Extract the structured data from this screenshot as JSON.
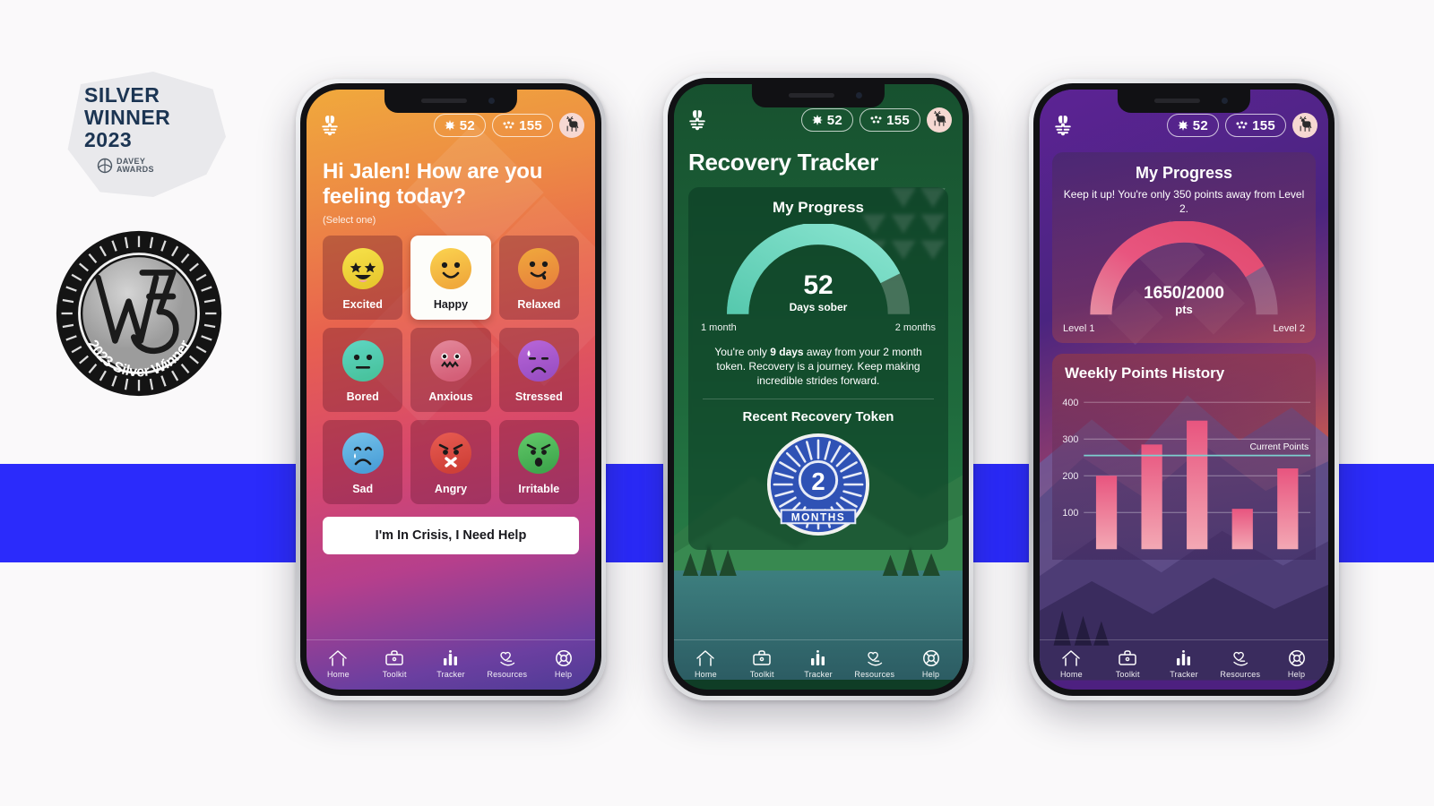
{
  "awards": {
    "davey": {
      "line1": "SILVER",
      "line2": "WINNER",
      "line3": "2023",
      "org_line1": "DAVEY",
      "org_line2": "AWARDS"
    },
    "w3": {
      "center": "W3",
      "ring_text": "2023 Silver Winner"
    }
  },
  "colors": {
    "band_blue": "#2b2bfb",
    "page_bg": "#faf9fa",
    "mood_accent": "#e8614f",
    "recovery_accent": "#6fd9c0",
    "points_accent": "#e8557f",
    "selected_card": "#fdfdfa"
  },
  "app": {
    "logo_icon": "butterfly-logo-icon",
    "streak_badge": {
      "icon": "spark-icon",
      "value": "52"
    },
    "points_badge": {
      "icon": "dots-cluster-icon",
      "value": "155"
    },
    "avatar_icon": "deer-avatar-icon"
  },
  "bottom_nav": {
    "items": [
      {
        "icon": "home-icon",
        "label": "Home"
      },
      {
        "icon": "toolkit-briefcase-icon",
        "label": "Toolkit"
      },
      {
        "icon": "tracker-bars-icon",
        "label": "Tracker"
      },
      {
        "icon": "resources-heart-hand-icon",
        "label": "Resources"
      },
      {
        "icon": "help-lifebuoy-icon",
        "label": "Help"
      }
    ]
  },
  "screen_mood": {
    "greeting": "Hi Jalen! How are you feeling today?",
    "select_hint": "(Select one)",
    "moods": [
      {
        "label": "Excited",
        "face": "star-eyes-grin",
        "color_a": "#f7e24a",
        "color_b": "#e8c82f",
        "selected": false
      },
      {
        "label": "Happy",
        "face": "smile",
        "color_a": "#fbd44f",
        "color_b": "#f0a93c",
        "selected": true
      },
      {
        "label": "Relaxed",
        "face": "smirk-tongue",
        "color_a": "#f0a93c",
        "color_b": "#e8853c",
        "selected": false
      },
      {
        "label": "Bored",
        "face": "flat-mouth",
        "color_a": "#5fd6c4",
        "color_b": "#49c39e",
        "selected": false
      },
      {
        "label": "Anxious",
        "face": "zigzag-mouth",
        "color_a": "#e4899b",
        "color_b": "#d45f78",
        "selected": false
      },
      {
        "label": "Stressed",
        "face": "sweat-frown",
        "color_a": "#b866d8",
        "color_b": "#9a4fc4",
        "selected": false
      },
      {
        "label": "Sad",
        "face": "tear-frown",
        "color_a": "#76c3ea",
        "color_b": "#4b9fd8",
        "selected": false
      },
      {
        "label": "Angry",
        "face": "x-mouth-angry",
        "color_a": "#e85c52",
        "color_b": "#cf4038",
        "selected": false
      },
      {
        "label": "Irritable",
        "face": "open-mouth-angry",
        "color_a": "#63c96a",
        "color_b": "#3fa74d",
        "selected": false
      }
    ],
    "crisis_button": "I'm In Crisis, I Need Help"
  },
  "screen_recovery": {
    "title": "Recovery Tracker",
    "card_title": "My Progress",
    "gauge_value": "52",
    "gauge_unit": "Days sober",
    "gauge_start_label": "1 month",
    "gauge_end_label": "2 months",
    "message_pre": "You're only ",
    "message_bold": "9 days",
    "message_post": " away from your 2 month token. Recovery is a journey. Keep making incredible strides forward.",
    "token_heading": "Recent Recovery Token",
    "token_number": "2",
    "token_unit": "MONTHS"
  },
  "screen_points": {
    "card_title": "My Progress",
    "subtitle": "Keep it up! You're only 350 points away from Level 2.",
    "gauge_value": "1650/2000",
    "gauge_unit": "pts",
    "gauge_start_label": "Level 1",
    "gauge_end_label": "Level 2",
    "history_title": "Weekly Points History"
  },
  "chart_data": {
    "type": "bar",
    "title": "Weekly Points History",
    "categories": [
      "",
      "",
      "",
      "",
      ""
    ],
    "values": [
      200,
      285,
      350,
      110,
      220
    ],
    "ytick_labels": [
      "100",
      "200",
      "300",
      "400"
    ],
    "yticks": [
      100,
      200,
      300,
      400
    ],
    "ylim": [
      0,
      430
    ],
    "xlabel": "",
    "ylabel": "",
    "grid": true,
    "legend_position": "inline-right",
    "annotations": [
      {
        "label": "Current Points",
        "type": "hline",
        "value": 255,
        "color": "#7ccfcf"
      }
    ],
    "bar_color_top": "#e8557f",
    "bar_color_bottom": "#f2a0ae"
  },
  "gauges": {
    "recovery": {
      "value": 52,
      "max": 61,
      "fill_fraction": 0.85,
      "track_color": "#ffffff33",
      "fill_color": "#6fd9c0"
    },
    "points": {
      "value": 1650,
      "max": 2000,
      "fill_fraction": 0.825,
      "track_color": "#ffffff2e",
      "fill_color": "#e8557f"
    }
  }
}
